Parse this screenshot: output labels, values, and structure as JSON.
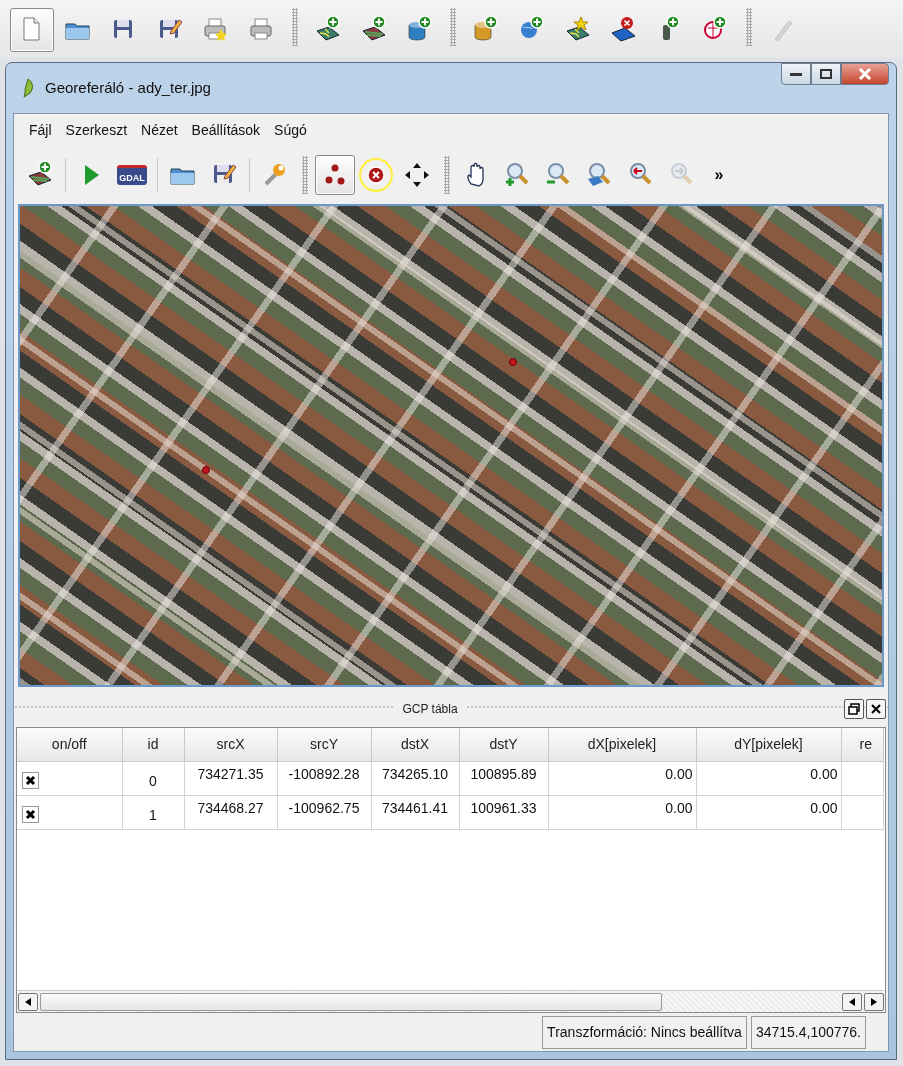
{
  "main_toolbar": [
    {
      "selected": true,
      "disabled": false
    },
    {
      "selected": false,
      "disabled": false
    },
    {
      "selected": false,
      "disabled": false
    },
    {
      "selected": false,
      "disabled": false
    },
    {
      "selected": false,
      "disabled": false
    },
    {
      "selected": false,
      "disabled": false
    },
    {
      "selected": false,
      "disabled": false
    },
    {
      "selected": false,
      "disabled": false
    },
    {
      "selected": false,
      "disabled": false
    },
    {
      "selected": false,
      "disabled": false
    },
    {
      "selected": false,
      "disabled": false
    },
    {
      "selected": false,
      "disabled": false
    },
    {
      "selected": false,
      "disabled": false
    },
    {
      "selected": false,
      "disabled": false
    },
    {
      "selected": false,
      "disabled": false
    },
    {
      "selected": false,
      "disabled": true
    }
  ],
  "window": {
    "title": "Georeferáló - ady_ter.jpg"
  },
  "menu": [
    "Fájl",
    "Szerkeszt",
    "Nézet",
    "Beállítások",
    "Súgó"
  ],
  "toolbar": {
    "overflow": "»",
    "items": [
      {
        "selected": false,
        "disabled": false
      },
      {
        "selected": false,
        "disabled": false
      },
      {
        "selected": false,
        "disabled": false,
        "label": "GDAL"
      },
      {
        "selected": false,
        "disabled": false
      },
      {
        "selected": false,
        "disabled": false
      },
      {
        "selected": false,
        "disabled": false
      },
      {
        "selected": true,
        "disabled": false
      },
      {
        "selected": false,
        "disabled": false
      },
      {
        "selected": false,
        "disabled": false
      },
      {
        "selected": false,
        "disabled": false
      },
      {
        "selected": false,
        "disabled": false
      },
      {
        "selected": false,
        "disabled": false
      },
      {
        "selected": false,
        "disabled": false
      },
      {
        "selected": false,
        "disabled": false
      },
      {
        "selected": false,
        "disabled": true
      }
    ]
  },
  "gcp_panel": {
    "title": "GCP tábla",
    "columns": [
      "on/off",
      "id",
      "srcX",
      "srcY",
      "dstX",
      "dstY",
      "dX[pixelek]",
      "dY[pixelek]",
      "re"
    ],
    "rows": [
      {
        "cells": [
          {
            "checked": true
          },
          "0",
          "734271.35",
          "-100892.28",
          "734265.10",
          "100895.89",
          "0.00",
          "0.00"
        ]
      },
      {
        "cells": [
          {
            "checked": true
          },
          "1",
          "734468.27",
          "-100962.75",
          "734461.41",
          "100961.33",
          "0.00",
          "0.00"
        ]
      }
    ]
  },
  "status_bar": [
    "Transzformáció: Nincs beállítva",
    "34715.4,100776."
  ]
}
